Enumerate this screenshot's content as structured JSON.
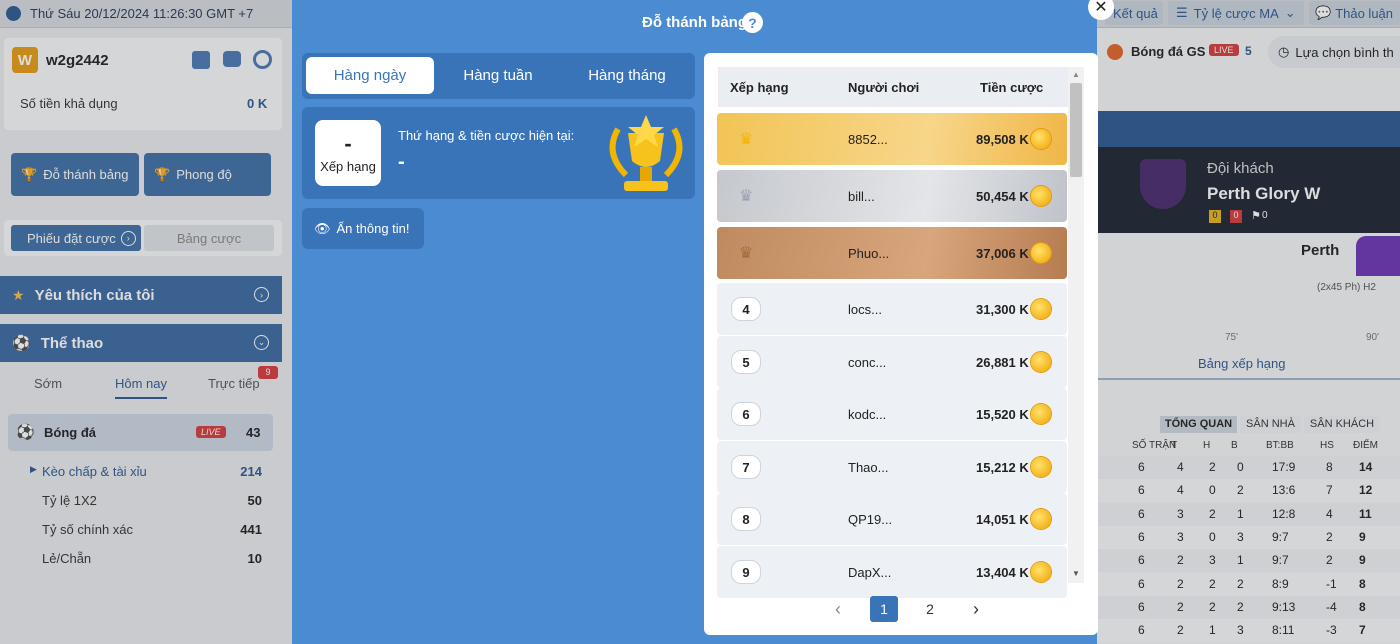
{
  "header": {
    "datetime": "Thứ Sáu 20/12/2024 11:26:30 GMT +7"
  },
  "sidebar": {
    "username": "w2g2442",
    "user_badge": "W",
    "balance_label": "Số tiền khả dụng",
    "balance_value": "0 K",
    "btn_leaderboard": "Đỗ thánh bảng",
    "btn_form": "Phong độ",
    "tab_betslip": "Phiếu đặt cược",
    "tab_bettable": "Bảng cược",
    "favorites": "Yêu thích của tôi",
    "sports": "Thể thao",
    "subtabs": [
      "Sớm",
      "Hôm nay",
      "Trực tiếp"
    ],
    "live_count": "9",
    "football_label": "Bóng đá",
    "live_badge": "LIVE",
    "football_count": "43",
    "markets": [
      {
        "label": "Kèo chấp & tài xỉu",
        "count": "214"
      },
      {
        "label": "Tỷ lệ 1X2",
        "count": "50"
      },
      {
        "label": "Tỷ số chính xác",
        "count": "441"
      },
      {
        "label": "Lẻ/Chẵn",
        "count": "10"
      }
    ]
  },
  "right": {
    "results": "Kết quả",
    "odds": "Tỷ lệ cược MA",
    "discuss": "Thảo luận",
    "gs_label": "Bóng đá GS",
    "gs_live": "LIVE",
    "gs_count": "5",
    "normal_choice": "Lựa chọn bình th",
    "away_label": "Đội khách",
    "team_name": "Perth Glory W",
    "team_short": "Perth",
    "stat_y": "0",
    "stat_r": "0",
    "stat_c": "0",
    "time_info": "(2x45 Ph) H2",
    "tick75": "75'",
    "tick90": "90'",
    "standings_link": "Bảng xếp hạng",
    "stand_tabs": [
      "TỔNG QUAN",
      "SÂN NHÀ",
      "SÂN KHÁCH"
    ],
    "stand_headers": [
      "SỐ TRẬN",
      "T",
      "H",
      "B",
      "BT:BB",
      "HS",
      "ĐIỂM"
    ],
    "stand_rows": [
      [
        "6",
        "4",
        "2",
        "0",
        "17:9",
        "8",
        "14"
      ],
      [
        "6",
        "4",
        "0",
        "2",
        "13:6",
        "7",
        "12"
      ],
      [
        "6",
        "3",
        "2",
        "1",
        "12:8",
        "4",
        "11"
      ],
      [
        "6",
        "3",
        "0",
        "3",
        "9:7",
        "2",
        "9"
      ],
      [
        "6",
        "2",
        "3",
        "1",
        "9:7",
        "2",
        "9"
      ],
      [
        "6",
        "2",
        "2",
        "2",
        "8:9",
        "-1",
        "8"
      ],
      [
        "6",
        "2",
        "2",
        "2",
        "9:13",
        "-4",
        "8"
      ],
      [
        "6",
        "2",
        "1",
        "3",
        "8:11",
        "-3",
        "7"
      ]
    ]
  },
  "modal": {
    "title": "Đỗ thánh bảng",
    "help": "?",
    "close": "✕",
    "tabs": [
      "Hàng ngày",
      "Hàng tuần",
      "Hàng tháng"
    ],
    "my_rank_value": "-",
    "my_rank_label": "Xếp hạng",
    "current_label": "Thứ hạng & tiền cược hiện tại:",
    "current_value": "-",
    "hide_info": "Ẩn thông tin!",
    "columns": [
      "Xếp hạng",
      "Người chơi",
      "Tiền cược"
    ],
    "rows": [
      {
        "rank": "",
        "player": "8852...",
        "amount": "89,508 K"
      },
      {
        "rank": "",
        "player": "bill...",
        "amount": "50,454 K"
      },
      {
        "rank": "",
        "player": "Phuo...",
        "amount": "37,006 K"
      },
      {
        "rank": "4",
        "player": "locs...",
        "amount": "31,300 K"
      },
      {
        "rank": "5",
        "player": "conc...",
        "amount": "26,881 K"
      },
      {
        "rank": "6",
        "player": "kodc...",
        "amount": "15,520 K"
      },
      {
        "rank": "7",
        "player": "Thao...",
        "amount": "15,212 K"
      },
      {
        "rank": "8",
        "player": "QP19...",
        "amount": "14,051 K"
      },
      {
        "rank": "9",
        "player": "DapX...",
        "amount": "13,404 K"
      }
    ],
    "pages": [
      "1",
      "2"
    ],
    "prev": "‹",
    "next": "›"
  }
}
